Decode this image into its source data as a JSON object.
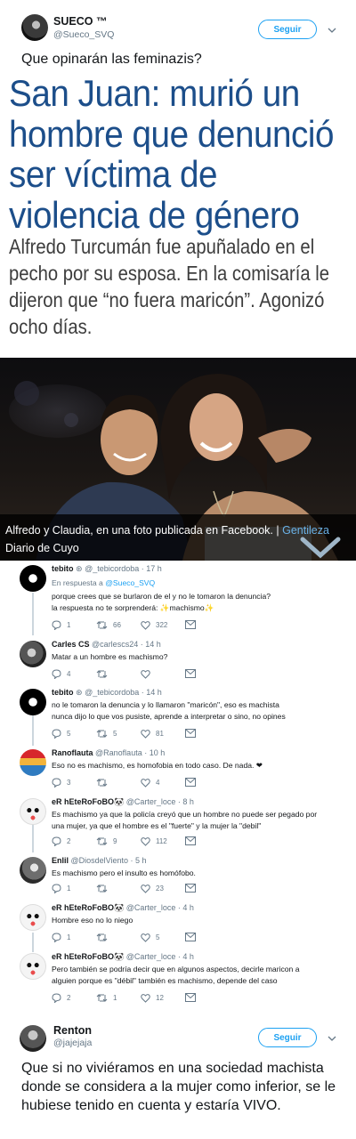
{
  "tweet": {
    "author_name": "SUECO ™",
    "author_handle": "@Sueco_SVQ",
    "follow_label": "Seguir",
    "text": "Que opinarán las feminazis?"
  },
  "article": {
    "headline": "San Juan: murió un hombre que denunció ser víctima de violencia de género",
    "subhead": "Alfredo Turcumán fue apuñalado en el pecho por su esposa. En la comisaría le dijeron que “no fuera maricón”. Agonizó ocho días.",
    "caption": "Alfredo y Claudia, en una foto publicada en Facebook. |",
    "caption_credit": "Gentileza",
    "caption_source": "Diario de Cuyo"
  },
  "replies": [
    {
      "name": "tebito",
      "badge": "⊛",
      "handle": "@_tebicordoba · 17 h",
      "reply_to_prefix": "En respuesta a ",
      "reply_to": "@Sueco_SVQ",
      "lines": [
        "porque crees que se burlaron de el y no le tomaron la denuncia?",
        "la respuesta no te sorprenderá: ✨machismo✨"
      ],
      "counts": {
        "replies": "1",
        "retweets": "66",
        "likes": "322"
      }
    },
    {
      "name": "Carles CS",
      "handle": "@carlescs24 · 14 h",
      "lines": [
        "Matar a un hombre es machismo?"
      ],
      "counts": {
        "replies": "4",
        "retweets": "",
        "likes": ""
      }
    },
    {
      "name": "tebito",
      "badge": "⊛",
      "handle": "@_tebicordoba · 14 h",
      "lines": [
        "no le tomaron la denuncia y lo llamaron \"maricón\", eso es machista",
        "nunca dijo lo que vos pusiste, aprende a interpretar o sino, no opines"
      ],
      "counts": {
        "replies": "5",
        "retweets": "5",
        "likes": "81"
      }
    },
    {
      "name": "Ranoflauta",
      "handle": "@Ranoflauta · 10 h",
      "lines": [
        "Eso no es machismo, es homofobia en todo caso. De nada. ❤"
      ],
      "counts": {
        "replies": "3",
        "retweets": "",
        "likes": "4"
      }
    },
    {
      "name": "eR hEteRoFoBO",
      "badge": "🐼",
      "handle": "@Carter_loce · 8 h",
      "lines": [
        "Es machismo ya que la policía creyó que un hombre no puede ser pegado por",
        "una mujer, ya que el hombre es el \"fuerte\" y la mujer la \"debil\""
      ],
      "counts": {
        "replies": "2",
        "retweets": "9",
        "likes": "112"
      }
    },
    {
      "name": "Enlil",
      "handle": "@DiosdelViento · 5 h",
      "lines": [
        "Es machismo pero el insulto es homófobo."
      ],
      "counts": {
        "replies": "1",
        "retweets": "",
        "likes": "23"
      }
    },
    {
      "name": "eR hEteRoFoBO",
      "badge": "🐼",
      "handle": "@Carter_loce · 4 h",
      "lines": [
        "Hombre eso no lo niego"
      ],
      "counts": {
        "replies": "1",
        "retweets": "",
        "likes": "5"
      }
    },
    {
      "name": "eR hEteRoFoBO",
      "badge": "🐼",
      "handle": "@Carter_loce · 4 h",
      "lines": [
        "Pero también  se podría decir que en algunos aspectos, decirle maricon a",
        "alguien porque es \"débil\" también es machismo, depende del caso"
      ],
      "counts": {
        "replies": "2",
        "retweets": "1",
        "likes": "12"
      }
    }
  ],
  "reply_tweet": {
    "author_name": "Renton",
    "author_handle": "@jajejaja",
    "follow_label": "Seguir",
    "text": "Que si no viviéramos en una sociedad machista donde se considera a la mujer como inferior, se le hubiese tenido en cuenta y estaría VIVO."
  },
  "colors": {
    "headline": "#1c4e8a",
    "link": "#1da1f2",
    "muted": "#657786",
    "caption_credit": "#6ab1e6"
  }
}
